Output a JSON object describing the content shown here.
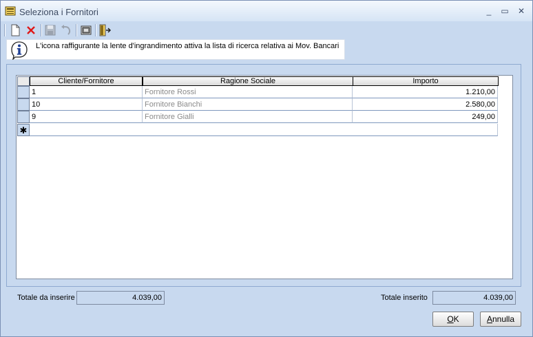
{
  "window": {
    "title": "Seleziona i Fornitori",
    "minimize_glyph": "_",
    "maximize_glyph": "▭",
    "close_glyph": "✕"
  },
  "toolbar": {
    "icons": [
      "new-document-icon",
      "delete-icon",
      "save-icon",
      "undo-icon",
      "select-icon",
      "exit-icon"
    ]
  },
  "info": {
    "text": "L'icona raffigurante la lente d'ingrandimento attiva la lista di ricerca relativa ai Mov. Bancari"
  },
  "grid": {
    "columns": [
      "Cliente/Fornitore",
      "Ragione Sociale",
      "Importo"
    ],
    "rows": [
      {
        "code": "1",
        "name": "Fornitore Rossi",
        "amount": "1.210,00"
      },
      {
        "code": "10",
        "name": "Fornitore Bianchi",
        "amount": "2.580,00"
      },
      {
        "code": "9",
        "name": "Fornitore Gialli",
        "amount": "249,00"
      }
    ],
    "new_row_marker": "✱"
  },
  "footer": {
    "to_insert_label": "Totale da inserire",
    "to_insert_value": "4.039,00",
    "inserted_label": "Totale inserito",
    "inserted_value": "4.039,00"
  },
  "buttons": {
    "ok_first": "O",
    "ok_rest": "K",
    "cancel_first": "A",
    "cancel_rest": "nnulla"
  },
  "colors": {
    "window_bg": "#c8d9ef",
    "delete_red": "#e01818"
  }
}
